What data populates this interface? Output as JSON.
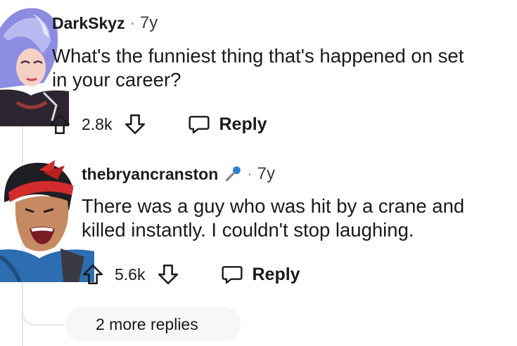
{
  "comments": [
    {
      "username": "DarkSkyz",
      "separator": "·",
      "age": "7y",
      "body_line1": "What's the funniest thing that's happened on set",
      "body_line2": "in your career?",
      "vote_count": "2.8k",
      "reply_label": "Reply"
    },
    {
      "username": "thebryancranston",
      "separator": "·",
      "age": "7y",
      "body_line1": "There was a guy who was hit by a crane and",
      "body_line2": "killed instantly. I couldn't stop laughing.",
      "vote_count": "5.6k",
      "reply_label": "Reply"
    }
  ],
  "more_replies_label": "2 more replies",
  "icons": {
    "upvote": "arrow-up-icon",
    "downvote": "arrow-down-icon",
    "reply": "speech-bubble-icon",
    "flair": "microphone-icon"
  },
  "colors": {
    "text": "#1a1a1b",
    "muted": "#7c7c7c",
    "thread_line": "#e4e6e8",
    "pill_bg": "#f6f7f8",
    "flair_blue": "#2a7fd4"
  }
}
